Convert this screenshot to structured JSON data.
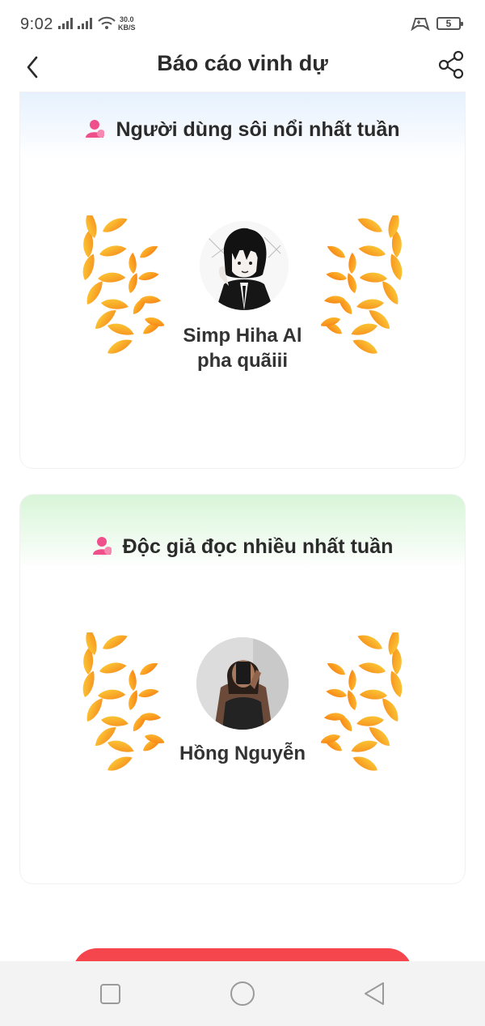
{
  "status_bar": {
    "time": "9:02",
    "net_speed_value": "30.0",
    "net_speed_unit": "KB/S",
    "battery_level": "5",
    "icons": [
      "signal-icon",
      "signal-icon",
      "wifi-icon",
      "game-mode-icon",
      "battery-icon"
    ]
  },
  "header": {
    "title": "Báo cáo vinh dự",
    "back_icon": "chevron-left-icon",
    "share_icon": "share-icon"
  },
  "sections": [
    {
      "title": "Người dùng sôi nổi nhất tuần",
      "icon": "person-icon",
      "winner_line1": "Simp Hiha Al",
      "winner_line2": "pha quãiii",
      "header_color": "#e6f1fd"
    },
    {
      "title": "Độc giả đọc nhiều nhất tuần",
      "icon": "person-icon",
      "winner_line1": "Hồng Nguyễn",
      "header_color": "#d8f5d8"
    }
  ],
  "colors": {
    "accent_pink": "#ef4f8b",
    "laurel_gold": "#fcb52a",
    "laurel_orange": "#f57f16",
    "cta_red": "#f5454d"
  },
  "nav_bar": {
    "icons": [
      "recent-apps-icon",
      "home-icon",
      "back-icon"
    ]
  }
}
